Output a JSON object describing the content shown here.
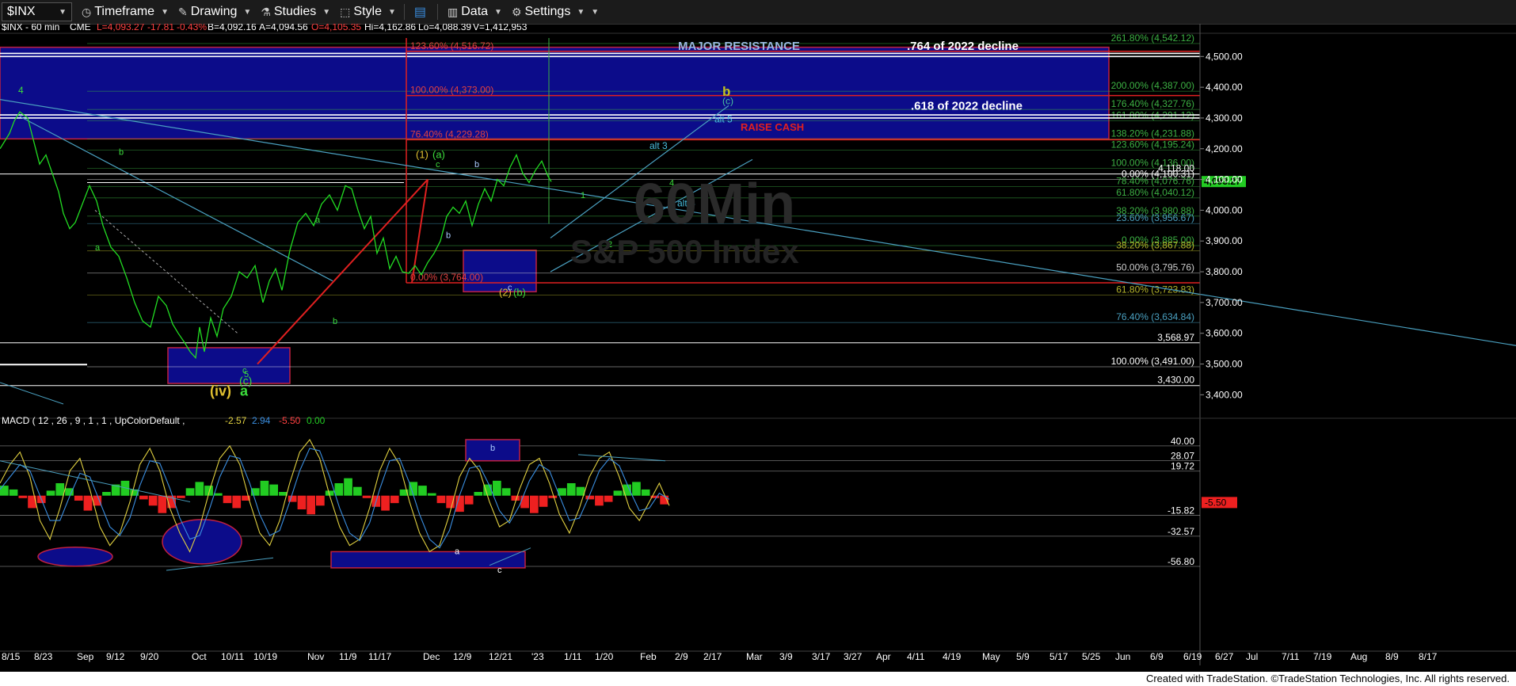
{
  "toolbar": {
    "symbol": "$INX",
    "timeframe": "Timeframe",
    "drawing": "Drawing",
    "studies": "Studies",
    "style": "Style",
    "data": "Data",
    "settings": "Settings",
    "icons": [
      "timeframe-icon",
      "drawing-icon",
      "studies-icon",
      "style-icon",
      "layout-icon",
      "data-icon",
      "settings-icon"
    ]
  },
  "header": {
    "symbol": "$INX - 60 min",
    "exchange": "CME",
    "last": "L=4,093.27",
    "change": "-17.81",
    "pct": "-0.43%",
    "bid": "B=4,092.16",
    "ask": "A=4,094.56",
    "open": "O=4,105.35",
    "hi": "Hi=4,162.86",
    "lo": "Lo=4,088.39",
    "vol": "V=1,412,953"
  },
  "watermark": {
    "tf": "60Min",
    "name": "S&P 500 Index"
  },
  "chart_data": {
    "type": "line",
    "title": "$INX - 60 min",
    "y_axis_labels": [
      "4,500.00",
      "4,400.00",
      "4,300.00",
      "4,200.00",
      "4,100.00",
      "4,000.00",
      "3,900.00",
      "3,800.00",
      "3,700.00",
      "3,600.00",
      "3,500.00",
      "3,400.00"
    ],
    "y_axis_values": [
      4500,
      4400,
      4300,
      4200,
      4100,
      4000,
      3900,
      3800,
      3700,
      3600,
      3500,
      3400
    ],
    "ylim": [
      3370,
      4560
    ],
    "last_price": {
      "label": "4,093.27",
      "value": 4093.27
    },
    "x_axis_labels": [
      "8/15",
      "8/23",
      "Sep",
      "9/12",
      "9/20",
      "Oct",
      "10/11",
      "10/19",
      "Nov",
      "11/9",
      "11/17",
      "Dec",
      "12/9",
      "12/21",
      "'23",
      "1/11",
      "1/20",
      "Feb",
      "2/9",
      "2/17",
      "Mar",
      "3/9",
      "3/17",
      "3/27",
      "Apr",
      "4/11",
      "4/19",
      "May",
      "5/9",
      "5/17",
      "5/25",
      "Jun",
      "6/9",
      "6/19",
      "6/27",
      "Jul",
      "7/11",
      "7/19",
      "Aug",
      "8/9",
      "8/17"
    ],
    "fib_levels": [
      {
        "label": "261.80% (4,542.12)",
        "value": 4542.12,
        "color": "#3cb043"
      },
      {
        "label": "200.00% (4,387.00)",
        "value": 4387.0,
        "color": "#3cb043"
      },
      {
        "label": "176.40% (4,327.76)",
        "value": 4327.76,
        "color": "#3cb043"
      },
      {
        "label": "161.80% (4,291.12)",
        "value": 4291.12,
        "color": "#3cb043"
      },
      {
        "label": "138.20% (4,231.88)",
        "value": 4231.88,
        "color": "#3cb043"
      },
      {
        "label": "123.60% (4,195.24)",
        "value": 4195.24,
        "color": "#3cb043"
      },
      {
        "label": "100.00% (4,136.00)",
        "value": 4136.0,
        "color": "#3cb043"
      },
      {
        "label": "0.00% (4,100.31)",
        "value": 4100.31,
        "color": "#ffffff"
      },
      {
        "label": "78.40% (4,076.76)",
        "value": 4076.76,
        "color": "#3cb043"
      },
      {
        "label": "61.80% (4,040.12)",
        "value": 4040.12,
        "color": "#3cb043"
      },
      {
        "label": "38.20% (3,980.88)",
        "value": 3980.88,
        "color": "#3cb043"
      },
      {
        "label": "23.60% (3,956.67)",
        "value": 3956.67,
        "color": "#4aa0c0"
      },
      {
        "label": "0.00% (3,885.00)",
        "value": 3885.0,
        "color": "#3cb043"
      },
      {
        "label": "38.20% (3,867.88)",
        "value": 3867.88,
        "color": "#b5b52a"
      },
      {
        "label": "50.00% (3,795.76)",
        "value": 3795.76,
        "color": "#cccccc"
      },
      {
        "label": "61.80% (3,723.83)",
        "value": 3723.83,
        "color": "#b5b52a"
      },
      {
        "label": "76.40% (3,634.84)",
        "value": 3634.84,
        "color": "#4aa0c0"
      },
      {
        "label": "100.00% (3,491.00)",
        "value": 3491.0,
        "color": "#ffffff"
      }
    ],
    "plain_levels": [
      {
        "label": "4,118.00",
        "value": 4118.0
      },
      {
        "label": "3,568.97",
        "value": 3568.97
      },
      {
        "label": "3,430.00",
        "value": 3430.0
      }
    ],
    "red_fibs": [
      {
        "label": "123.60% (4,516.72)",
        "value": 4516.72
      },
      {
        "label": "100.00% (4,373.00)",
        "value": 4373.0
      },
      {
        "label": "76.40% (4,229.28)",
        "value": 4229.28
      },
      {
        "label": "0.00% (3,764.00)",
        "value": 3764.0
      }
    ],
    "annotations": {
      "major_resistance": "MAJOR RESISTANCE",
      "decline_764": ".764 of 2022 decline",
      "decline_618": ".618 of 2022 decline",
      "raise_cash": "RAISE CASH",
      "alt5": "alt 5",
      "alt3": "alt 3",
      "alt4": "alt 4",
      "wave_b_big": "b",
      "wave_c_paren": "(c)",
      "wave_iv": "(iv)",
      "wave_a_big": "a",
      "wave_c_low": "(c)",
      "wave_5_low": "5",
      "wave_c_small": "c",
      "wave_1": "(1)",
      "wave_a_paren": "(a)",
      "wave_2": "(2)",
      "wave_b_paren": "(b)",
      "wave_4": "4",
      "lbl_b1": "b",
      "lbl_a1": "a",
      "lbl_b2": "b",
      "lbl_a2": "a",
      "lbl_b3": "b",
      "lbl_c3": "c",
      "lbl_b4": "b",
      "lbl_a3": "a",
      "lbl_c4": "c",
      "lbl_1": "1",
      "lbl_2": "2",
      "lbl_4s": "4"
    },
    "series": [
      {
        "name": "$INX",
        "color": "#22dd22",
        "x": [
          0,
          12,
          18,
          25,
          35,
          42,
          50,
          58,
          66,
          74,
          80,
          88,
          95,
          104,
          113,
          122,
          130,
          140,
          150,
          160,
          170,
          180,
          190,
          200,
          210,
          218,
          225,
          233,
          240,
          247,
          252,
          258,
          266,
          274,
          282,
          292,
          302,
          312,
          322,
          332,
          340,
          348,
          356,
          366,
          376,
          386,
          396,
          406,
          416,
          426,
          436,
          444,
          452,
          460,
          468,
          476,
          484,
          492,
          500,
          508,
          516,
          524,
          532,
          540,
          548,
          556,
          564,
          572,
          580,
          588,
          596,
          604,
          612,
          620,
          628,
          636,
          644,
          652,
          660,
          668,
          676,
          684,
          692,
          696
        ],
        "y": [
          4200,
          4250,
          4290,
          4320,
          4300,
          4230,
          4150,
          4180,
          4120,
          4060,
          3990,
          3940,
          3960,
          4020,
          4080,
          4030,
          3950,
          3880,
          3850,
          3780,
          3700,
          3640,
          3620,
          3720,
          3690,
          3630,
          3600,
          3570,
          3540,
          3520,
          3620,
          3540,
          3650,
          3590,
          3680,
          3720,
          3800,
          3780,
          3820,
          3700,
          3770,
          3810,
          3740,
          3870,
          3960,
          3990,
          3950,
          4020,
          4050,
          4000,
          4080,
          4070,
          4000,
          3940,
          3980,
          3860,
          3910,
          3810,
          3850,
          3800,
          3795,
          3820,
          3790,
          3830,
          3860,
          3900,
          3980,
          4010,
          3990,
          4030,
          3950,
          4020,
          4070,
          4030,
          4100,
          4080,
          4140,
          4180,
          4120,
          4090,
          4130,
          4160,
          4110,
          4093
        ]
      }
    ],
    "macd": {
      "label": "MACD ( 12 , 26 , 9 , 1 , 1 , UpColorDefault , -2.57 2.94 -5.50 0.00",
      "title": "MACD ( 12 , 26 , 9 , 1 , 1 , UpColorDefault ,",
      "v1": "-2.57",
      "v2": "2.94",
      "v3": "-5.50",
      "v4": "0.00",
      "axis_labels": [
        "40.00",
        "28.07",
        "19.72",
        "-15.82",
        "-32.57",
        "-56.80"
      ],
      "axis_values": [
        40,
        28.07,
        19.72,
        -15.82,
        -32.57,
        -56.8
      ],
      "ylim": [
        -60,
        45
      ],
      "current": {
        "label": "-5.50",
        "value": -5.5
      },
      "histogram": [
        8,
        5,
        -2,
        -10,
        -6,
        4,
        10,
        6,
        -4,
        -12,
        -8,
        3,
        9,
        12,
        5,
        -3,
        -8,
        -14,
        -10,
        -2,
        6,
        11,
        8,
        2,
        -6,
        -10,
        -4,
        6,
        12,
        9,
        3,
        -5,
        -11,
        -15,
        -8,
        4,
        10,
        14,
        7,
        -2,
        -9,
        -12,
        -6,
        5,
        11,
        8,
        2,
        -6,
        -10,
        -13,
        -7,
        3,
        9,
        12,
        6,
        -4,
        -10,
        -14,
        -9,
        -2,
        6,
        10,
        7,
        -3,
        -8,
        -5,
        4,
        9,
        11,
        5,
        -2,
        -7
      ],
      "macd_line": [
        10,
        25,
        35,
        15,
        -20,
        -35,
        -10,
        20,
        30,
        5,
        -25,
        -40,
        -30,
        -5,
        25,
        38,
        20,
        -10,
        -30,
        -45,
        -25,
        5,
        30,
        40,
        25,
        -5,
        -30,
        -40,
        -20,
        10,
        35,
        45,
        30,
        0,
        -25,
        -40,
        -35,
        -10,
        20,
        38,
        25,
        -5,
        -30,
        -45,
        -40,
        -15,
        15,
        30,
        20,
        -5,
        -25,
        -20,
        5,
        25,
        30,
        10,
        -15,
        -30,
        -10,
        15,
        30,
        35,
        15,
        -10,
        -20,
        -5,
        10,
        -8
      ],
      "signal_line": [
        5,
        15,
        25,
        20,
        0,
        -20,
        -20,
        0,
        18,
        15,
        -5,
        -25,
        -32,
        -18,
        8,
        28,
        26,
        6,
        -18,
        -35,
        -32,
        -10,
        15,
        32,
        30,
        10,
        -15,
        -32,
        -28,
        -5,
        20,
        38,
        36,
        15,
        -10,
        -30,
        -36,
        -22,
        5,
        28,
        30,
        10,
        -15,
        -35,
        -42,
        -28,
        0,
        22,
        24,
        8,
        -12,
        -22,
        -8,
        12,
        25,
        20,
        0,
        -20,
        -18,
        0,
        20,
        30,
        24,
        5,
        -12,
        -10,
        2,
        -3
      ]
    }
  }
}
